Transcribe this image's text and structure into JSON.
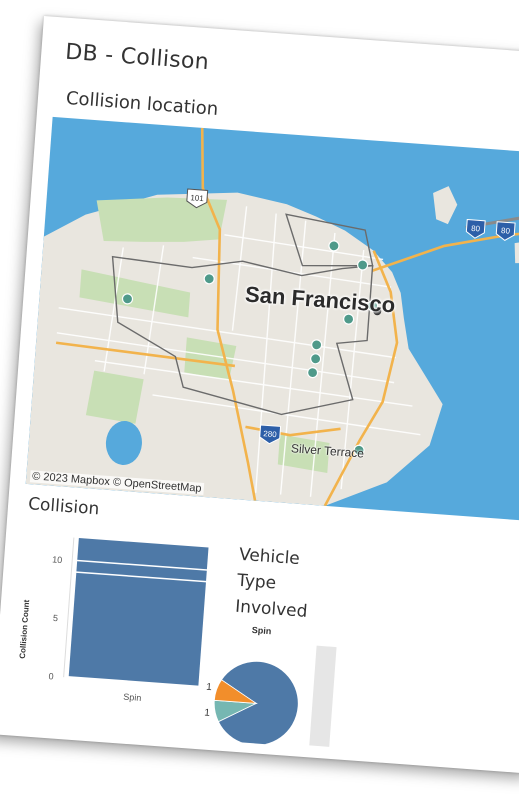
{
  "dashboard": {
    "title": "DB - Collison"
  },
  "map_panel": {
    "title": "Collision location",
    "city_label": "San Francisco",
    "place_label": "Silver Terrace",
    "credit": "© 2023 Mapbox © OpenStreetMap",
    "highway_shields": [
      "101",
      "280",
      "80",
      "80"
    ],
    "colors": {
      "water": "#56a9dc",
      "land": "#e9e6df",
      "park": "#c8dfb5",
      "road": "#f2b34c",
      "marker": "#4f9a8a"
    },
    "marker_count": 10
  },
  "collision_panel": {
    "title": "Collision",
    "chart_data": {
      "type": "bar",
      "categories": [
        "Spin"
      ],
      "values": [
        12
      ],
      "stack_values": [
        9,
        1,
        2
      ],
      "ylabel": "Collision Count",
      "xlabel": "",
      "yticks": [
        0,
        5,
        10
      ],
      "ylim": [
        0,
        12
      ],
      "color": "#4e79a7"
    }
  },
  "vehicle_panel": {
    "title": "Vehicle\nType\nInvolved",
    "chart_data": {
      "type": "pie",
      "header": "Spin",
      "slices": [
        {
          "value": 10,
          "label": "",
          "color": "#4e79a7"
        },
        {
          "value": 1,
          "label": "1",
          "color": "#76b7b2"
        },
        {
          "value": 1,
          "label": "1",
          "color": "#f28e2b"
        }
      ]
    }
  }
}
